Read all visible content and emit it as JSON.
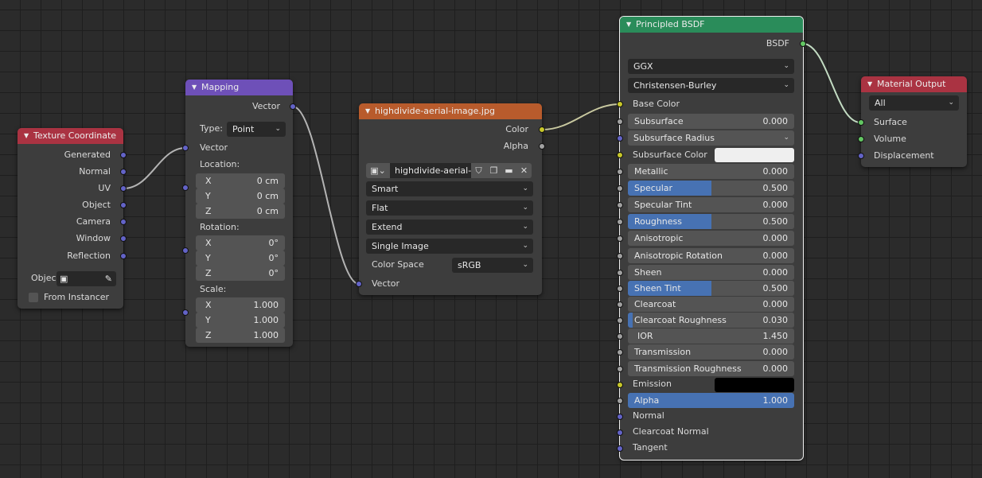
{
  "texture_coordinate": {
    "title": "Texture Coordinate",
    "outputs": [
      "Generated",
      "Normal",
      "UV",
      "Object",
      "Camera",
      "Window",
      "Reflection"
    ],
    "object_label": "Objec",
    "from_instancer_label": "From Instancer",
    "from_instancer_checked": false
  },
  "mapping": {
    "title": "Mapping",
    "output_vector": "Vector",
    "type_label": "Type:",
    "type_value": "Point",
    "input_vector": "Vector",
    "location_label": "Location:",
    "location": [
      {
        "axis": "X",
        "value": "0 cm"
      },
      {
        "axis": "Y",
        "value": "0 cm"
      },
      {
        "axis": "Z",
        "value": "0 cm"
      }
    ],
    "rotation_label": "Rotation:",
    "rotation": [
      {
        "axis": "X",
        "value": "0°"
      },
      {
        "axis": "Y",
        "value": "0°"
      },
      {
        "axis": "Z",
        "value": "0°"
      }
    ],
    "scale_label": "Scale:",
    "scale": [
      {
        "axis": "X",
        "value": "1.000"
      },
      {
        "axis": "Y",
        "value": "1.000"
      },
      {
        "axis": "Z",
        "value": "1.000"
      }
    ]
  },
  "image_texture": {
    "title": "highdivide-aerial-image.jpg",
    "out_color": "Color",
    "out_alpha": "Alpha",
    "image_name": "highdivide-aerial-...",
    "interpolation": "Smart",
    "projection": "Flat",
    "extension": "Extend",
    "source": "Single Image",
    "color_space_label": "Color Space",
    "color_space": "sRGB",
    "in_vector": "Vector"
  },
  "principled": {
    "title": "Principled BSDF",
    "output": "BSDF",
    "distribution": "GGX",
    "subsurface_method": "Christensen-Burley",
    "base_color": "Base Color",
    "subsurface": {
      "label": "Subsurface",
      "value": "0.000"
    },
    "subsurface_radius": "Subsurface Radius",
    "subsurface_color": "Subsurface Color",
    "metallic": {
      "label": "Metallic",
      "value": "0.000"
    },
    "specular": {
      "label": "Specular",
      "value": "0.500",
      "fraction": 0.5
    },
    "specular_tint": {
      "label": "Specular Tint",
      "value": "0.000"
    },
    "roughness": {
      "label": "Roughness",
      "value": "0.500",
      "fraction": 0.5
    },
    "anisotropic": {
      "label": "Anisotropic",
      "value": "0.000"
    },
    "anisotropic_rotation": {
      "label": "Anisotropic Rotation",
      "value": "0.000"
    },
    "sheen": {
      "label": "Sheen",
      "value": "0.000"
    },
    "sheen_tint": {
      "label": "Sheen Tint",
      "value": "0.500",
      "fraction": 0.5
    },
    "clearcoat": {
      "label": "Clearcoat",
      "value": "0.000"
    },
    "clearcoat_roughness": {
      "label": "Clearcoat Roughness",
      "value": "0.030",
      "fraction": 0.03
    },
    "ior": {
      "label": "IOR",
      "value": "1.450"
    },
    "transmission": {
      "label": "Transmission",
      "value": "0.000"
    },
    "transmission_roughness": {
      "label": "Transmission Roughness",
      "value": "0.000"
    },
    "emission": "Emission",
    "alpha": {
      "label": "Alpha",
      "value": "1.000",
      "fraction": 1.0
    },
    "normal": "Normal",
    "clearcoat_normal": "Clearcoat Normal",
    "tangent": "Tangent",
    "subsurface_color_value": "#efefef",
    "emission_color_value": "#000000"
  },
  "material_output": {
    "title": "Material Output",
    "target": "All",
    "inputs": [
      "Surface",
      "Volume",
      "Displacement"
    ]
  },
  "colors": {
    "header_input": "#aa3342",
    "header_vector": "#6e50b8",
    "header_texture": "#b85b2c",
    "header_shader": "#2a8c5a",
    "slider_fill": "#4772b3",
    "socket_vector": "#6363c7",
    "socket_color": "#c7c729",
    "socket_float": "#a1a1a1",
    "socket_shader": "#63c763"
  }
}
